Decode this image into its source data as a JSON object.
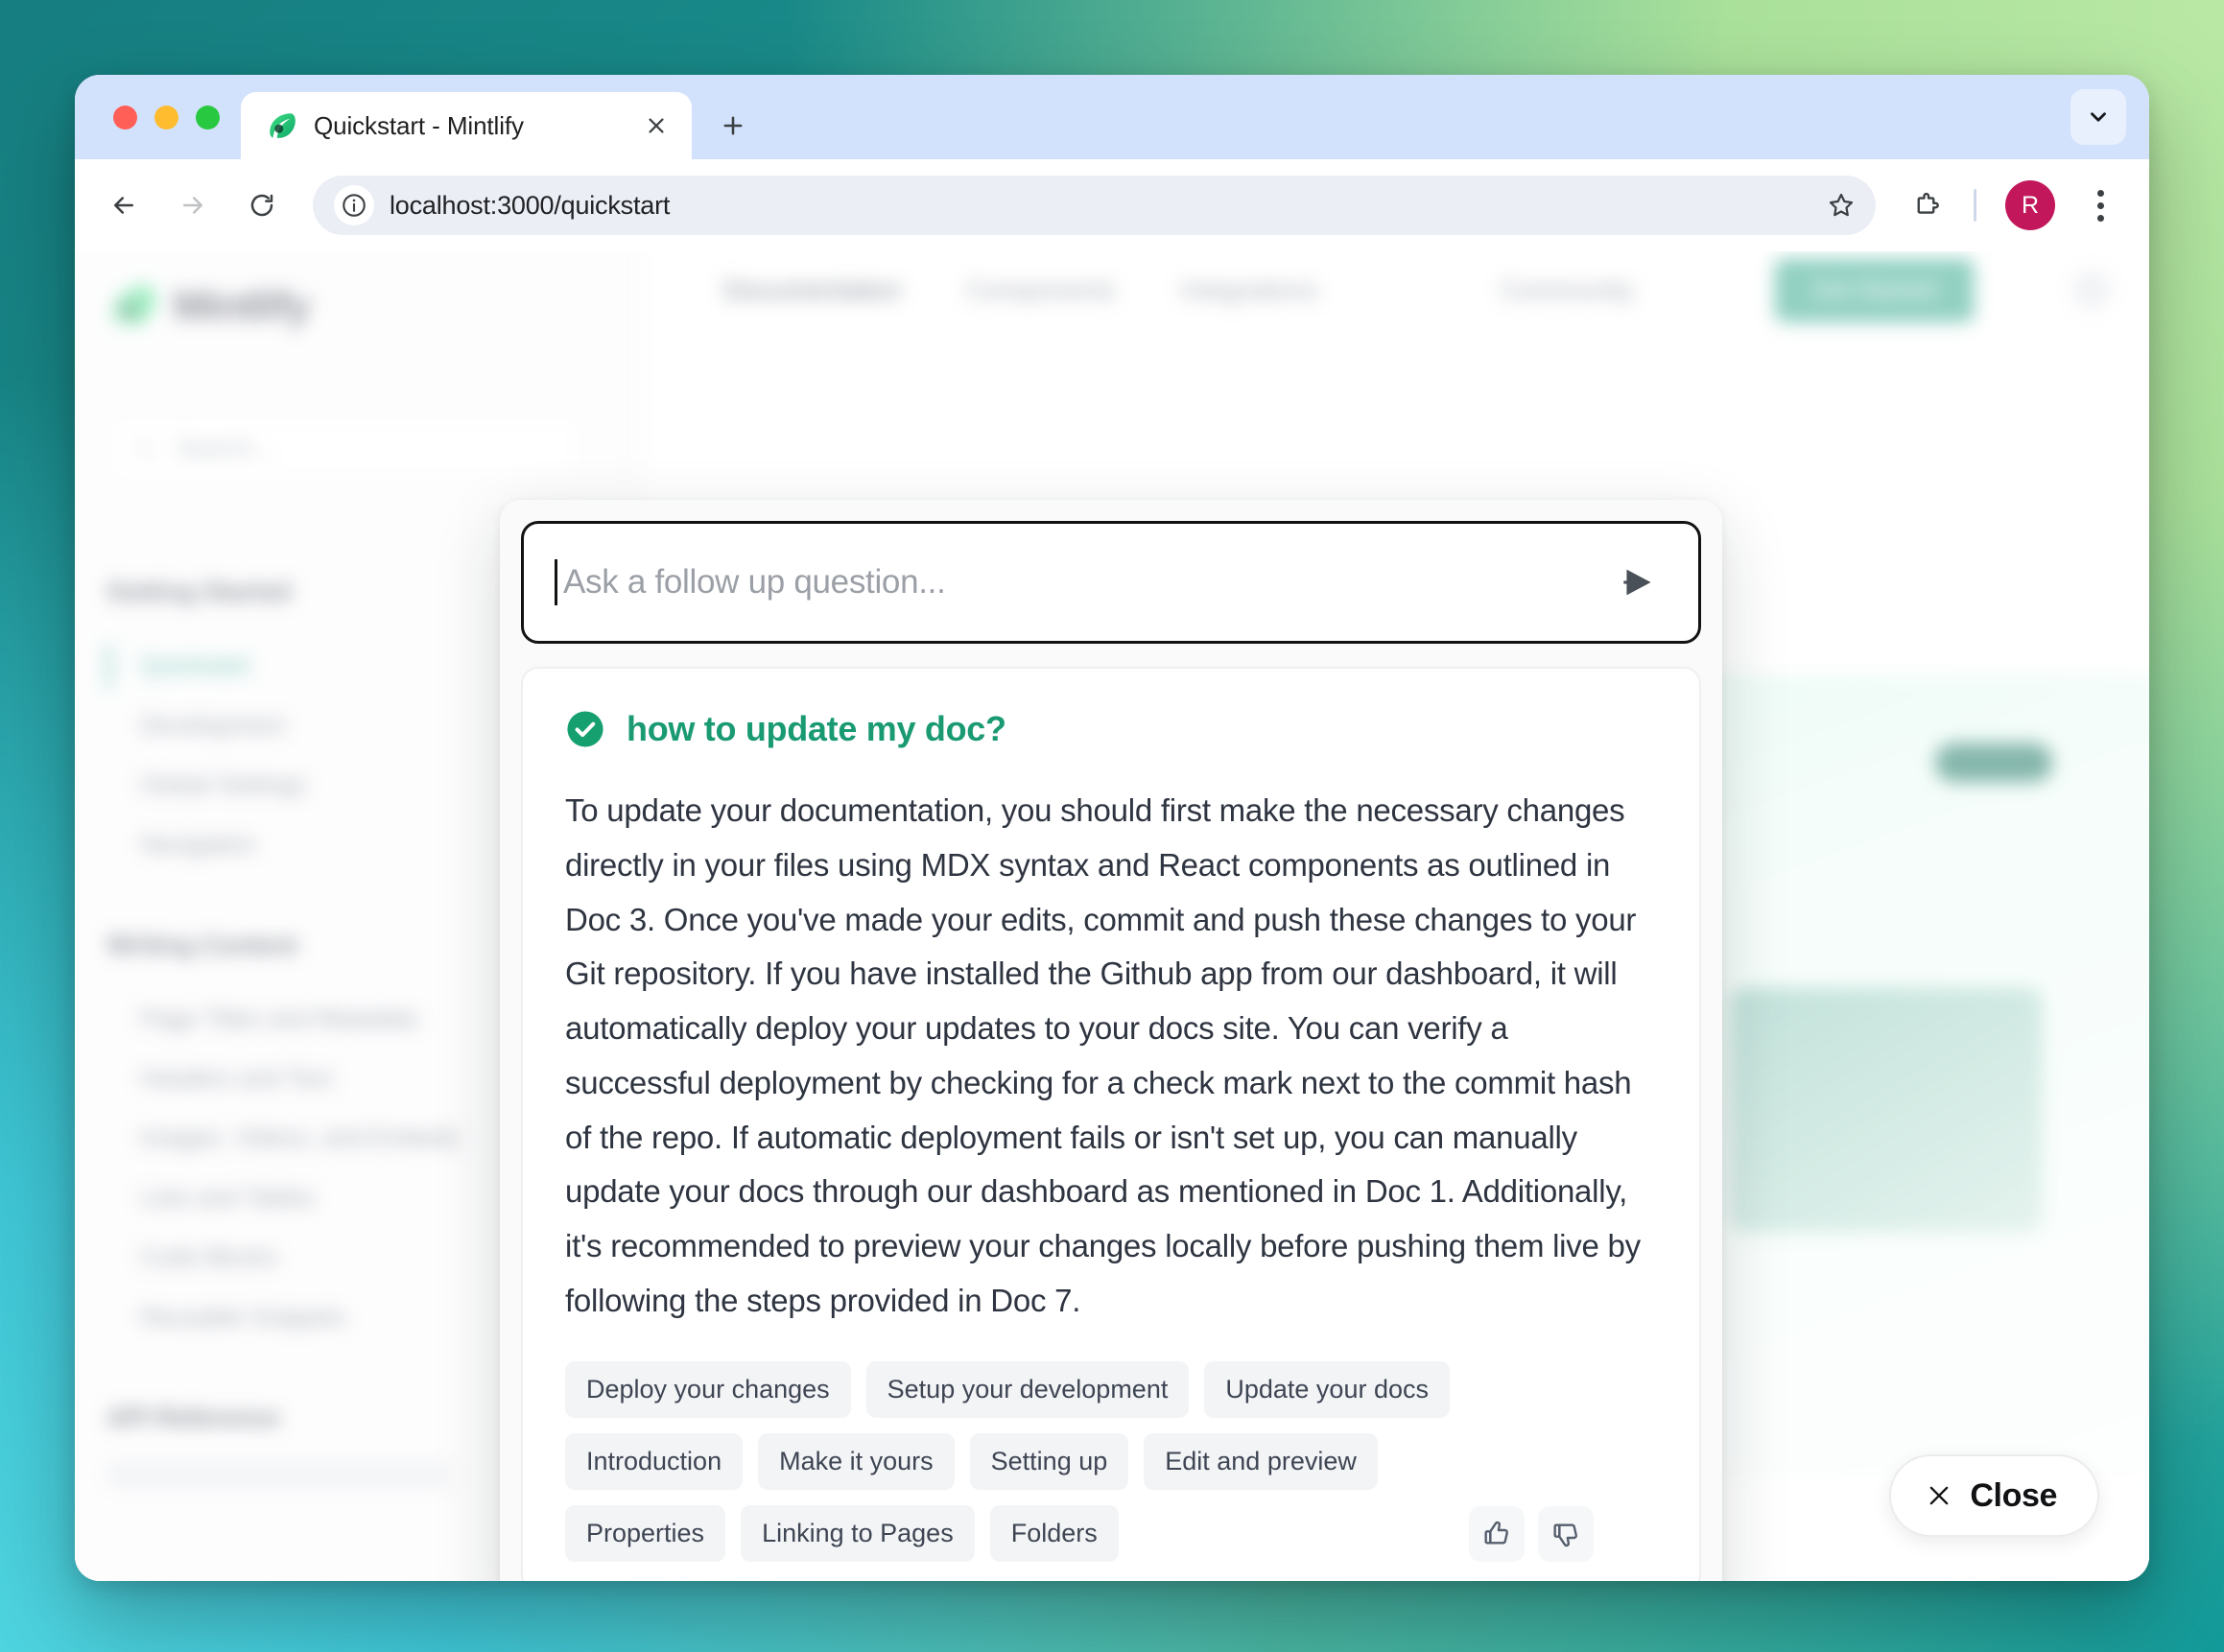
{
  "browser": {
    "tab": {
      "title": "Quickstart - Mintlify",
      "favicon_icon": "mintlify-leaf-icon",
      "close_icon": "close-icon"
    },
    "new_tab_icon": "plus-icon",
    "tabstrip_chevron_icon": "chevron-down-icon",
    "toolbar": {
      "back_icon": "arrow-left-icon",
      "forward_icon": "arrow-right-icon",
      "reload_icon": "reload-icon",
      "site_info_icon": "info-circle-icon",
      "url": "localhost:3000/quickstart",
      "bookmark_icon": "star-icon",
      "extensions_icon": "puzzle-piece-icon",
      "profile_initial": "R",
      "profile_color": "#c2185b",
      "menu_icon": "kebab-menu-icon"
    }
  },
  "page": {
    "brand_name": "Mintlify",
    "search_placeholder": "Search...",
    "topnav": {
      "links": [
        "Documentation",
        "Components",
        "Integrations",
        "Community"
      ],
      "cta_label": "Get Started"
    },
    "sidebar": {
      "groups": [
        {
          "title": "Getting Started",
          "items": [
            "Quickstart",
            "Development",
            "Global Settings",
            "Navigation"
          ]
        },
        {
          "title": "Writing Content",
          "items": [
            "Page Titles and Metadata",
            "Headers and Text",
            "Images, Videos, and Embeds",
            "Lists and Tables",
            "Code Blocks",
            "Reusable Snippets"
          ]
        },
        {
          "title": "API Reference",
          "items": []
        }
      ]
    }
  },
  "chat": {
    "input": {
      "placeholder": "Ask a follow up question...",
      "value": "",
      "send_icon": "send-arrow-icon"
    },
    "answer": {
      "status_icon": "check-circle-icon",
      "status_color": "#17a06f",
      "question": "how to update my doc?",
      "body": "To update your documentation, you should first make the necessary changes directly in your files using MDX syntax and React components as outlined in Doc 3. Once you've made your edits, commit and push these changes to your Git repository. If you have installed the Github app from our dashboard, it will automatically deploy your updates to your docs site. You can verify a successful deployment by checking for a check mark next to the commit hash of the repo. If automatic deployment fails or isn't set up, you can manually update your docs through our dashboard as mentioned in Doc 1. Additionally, it's recommended to preview your changes locally before pushing them live by following the steps provided in Doc 7.",
      "sources": [
        "Deploy your changes",
        "Setup your development",
        "Update your docs",
        "Introduction",
        "Make it yours",
        "Setting up",
        "Edit and preview",
        "Properties",
        "Linking to Pages",
        "Folders"
      ],
      "thumbs_up_icon": "thumbs-up-icon",
      "thumbs_down_icon": "thumbs-down-icon"
    }
  },
  "close_button": {
    "label": "Close",
    "icon": "close-x-icon"
  }
}
